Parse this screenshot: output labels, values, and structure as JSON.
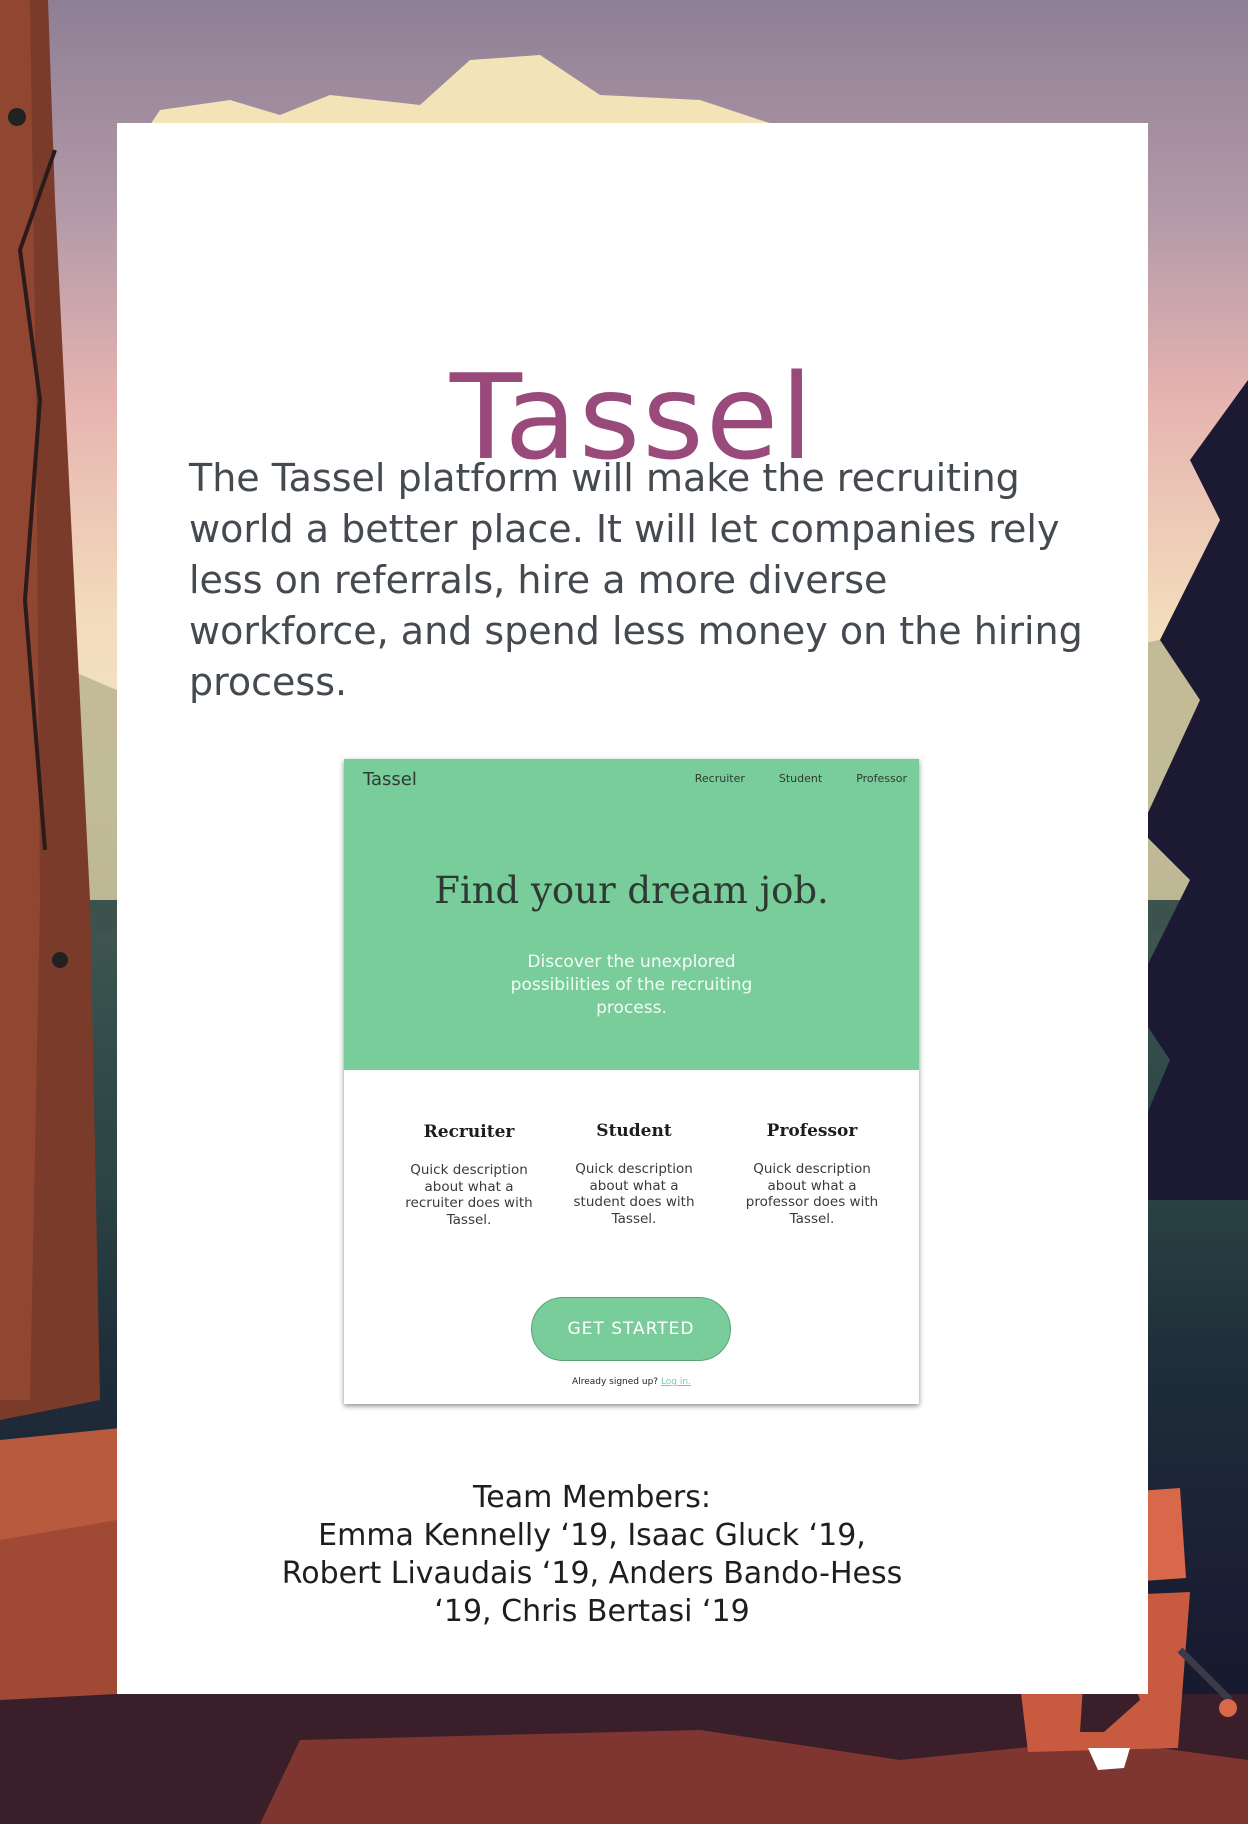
{
  "poster": {
    "title": "Tassel",
    "description": "The Tassel platform will make the recruiting world a better place. It will let companies rely less on referrals, hire a more diverse workforce, and spend less money on the hiring process.",
    "team_label": "Team Members:",
    "team_names": "Emma Kennelly ‘19, Isaac Gluck ‘19, Robert Livaudais ‘19, Anders Bando-Hess ‘19, Chris Bertasi ‘19"
  },
  "mockup": {
    "brand": "Tassel",
    "nav": [
      "Recruiter",
      "Student",
      "Professor"
    ],
    "headline": "Find your dream job.",
    "subheadline": "Discover the unexplored possibilities of the recruiting process.",
    "roles": [
      {
        "title": "Recruiter",
        "description": "Quick description about what a recruiter does with Tassel."
      },
      {
        "title": "Student",
        "description": "Quick description about what a student does with Tassel."
      },
      {
        "title": "Professor",
        "description": "Quick description about what a professor does with Tassel."
      }
    ],
    "cta": "GET STARTED",
    "signup_prompt": "Already signed up?",
    "login_link": "Log in."
  },
  "colors": {
    "accent_green": "#79cd9a",
    "title_plum": "#9a4a7a"
  }
}
